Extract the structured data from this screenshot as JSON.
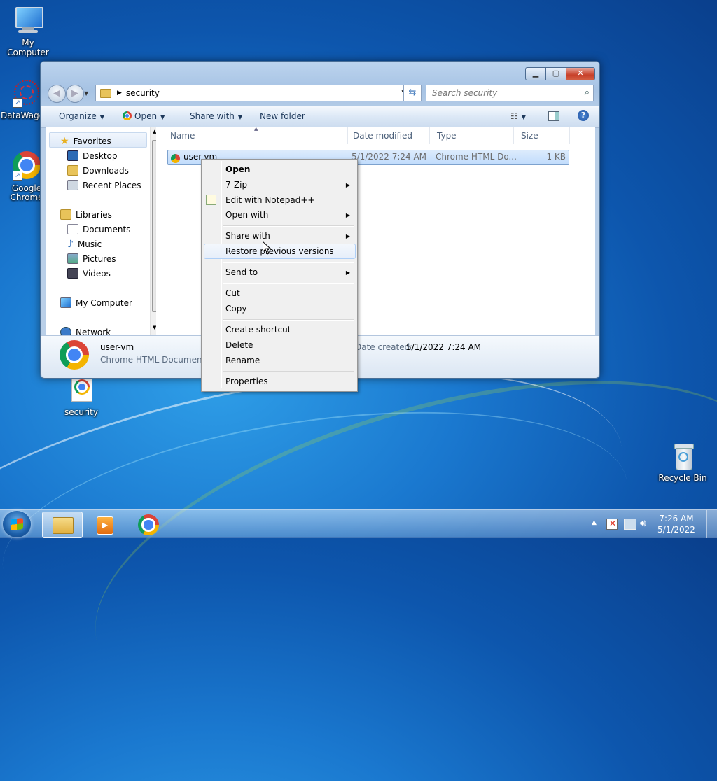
{
  "desktop": {
    "icons": [
      {
        "label": "My Computer"
      },
      {
        "label": "DataWago"
      },
      {
        "label": "Google Chrome",
        "label_line1": "Google",
        "label_line2": "Chrome"
      },
      {
        "label": "security"
      },
      {
        "label": "Recycle Bin"
      }
    ]
  },
  "window": {
    "address": {
      "path": "security"
    },
    "search": {
      "placeholder": "Search security"
    },
    "toolbar": {
      "organize": "Organize",
      "open": "Open",
      "share_with": "Share with",
      "new_folder": "New folder"
    },
    "nav": {
      "favorites": "Favorites",
      "desktop": "Desktop",
      "downloads": "Downloads",
      "recent_places": "Recent Places",
      "libraries": "Libraries",
      "documents": "Documents",
      "music": "Music",
      "pictures": "Pictures",
      "videos": "Videos",
      "my_computer": "My Computer",
      "network": "Network"
    },
    "columns": {
      "name": "Name",
      "date_modified": "Date modified",
      "type": "Type",
      "size": "Size"
    },
    "files": [
      {
        "name": "user-vm",
        "date_modified": "5/1/2022 7:24 AM",
        "type": "Chrome HTML Do...",
        "size": "1 KB"
      }
    ],
    "details": {
      "name": "user-vm",
      "type": "Chrome HTML Document",
      "date_created_label": "Date created:",
      "date_created": "5/1/2022 7:24 AM"
    }
  },
  "context_menu": {
    "items": [
      {
        "label": "Open"
      },
      {
        "label": "7-Zip"
      },
      {
        "label": "Edit with Notepad++"
      },
      {
        "label": "Open with"
      },
      {
        "label": "Share with"
      },
      {
        "label": "Restore previous versions"
      },
      {
        "label": "Send to"
      },
      {
        "label": "Cut"
      },
      {
        "label": "Copy"
      },
      {
        "label": "Create shortcut"
      },
      {
        "label": "Delete"
      },
      {
        "label": "Rename"
      },
      {
        "label": "Properties"
      }
    ]
  },
  "taskbar": {
    "clock_time": "7:26 AM",
    "clock_date": "5/1/2022",
    "tray_arrow": "▲"
  },
  "colors": {
    "selection": "#c1dcfc",
    "taskbar": "#6e96c8",
    "desktop": "#1a78cf"
  }
}
